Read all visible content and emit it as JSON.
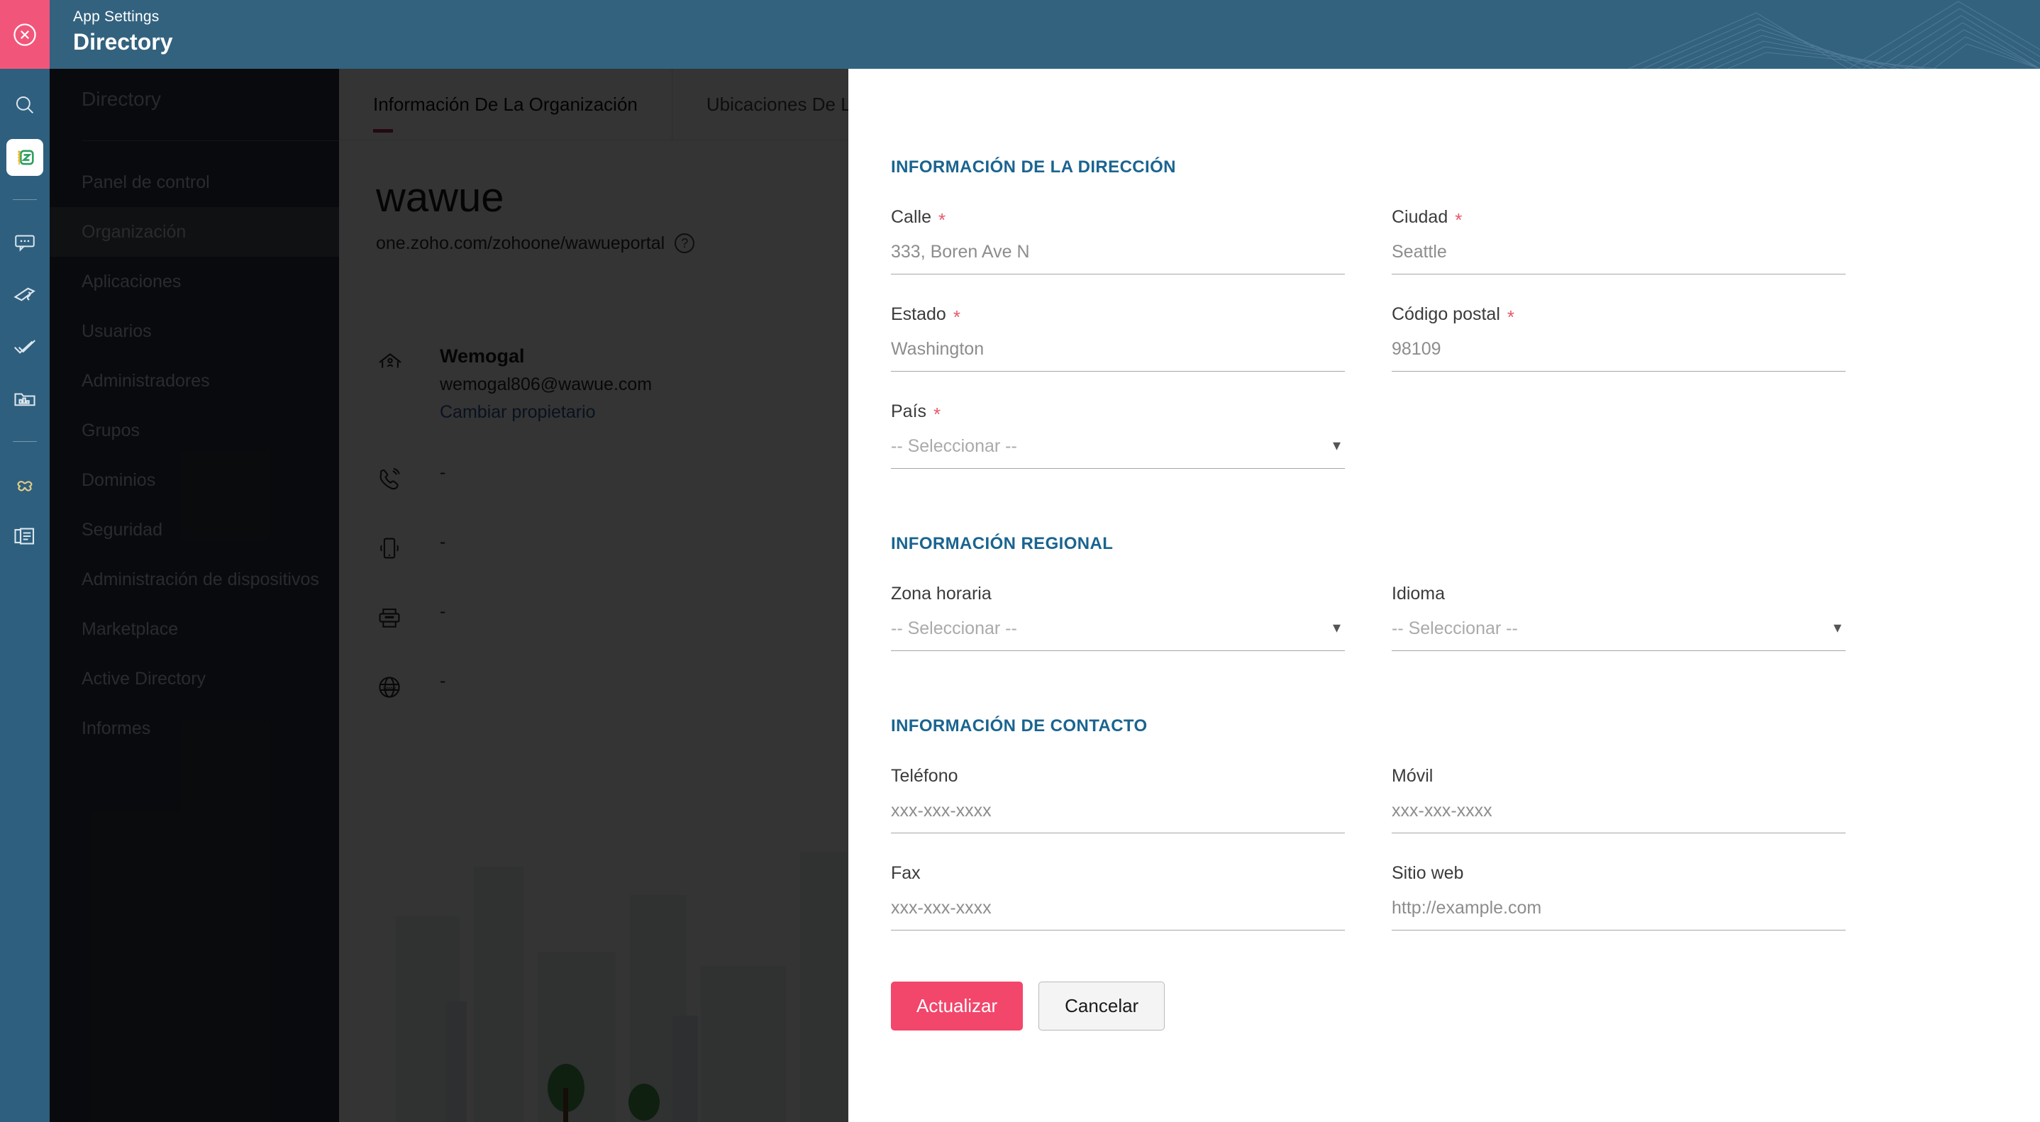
{
  "topbar": {
    "kicker": "App Settings",
    "title": "Directory",
    "close_icon": "close-circle-icon",
    "accent_close_bg": "#f2557a",
    "bg": "#33627f"
  },
  "rail": {
    "bg": "#2e5f7e",
    "items": [
      {
        "icon": "search-icon",
        "active": false
      },
      {
        "icon": "zoho-one-logo-icon",
        "active": true
      },
      {
        "icon": "chat-bubble-icon",
        "active": false
      },
      {
        "icon": "writer-pen-icon",
        "active": false
      },
      {
        "icon": "double-check-icon",
        "active": false
      },
      {
        "icon": "analytics-folder-icon",
        "active": false
      },
      {
        "icon": "flow-puzzle-icon",
        "active": false
      },
      {
        "icon": "documents-stack-icon",
        "active": false
      }
    ]
  },
  "sidebar": {
    "title": "Directory",
    "items": [
      {
        "label": "Panel de control",
        "selected": false
      },
      {
        "label": "Organización",
        "selected": true
      },
      {
        "label": "Aplicaciones",
        "selected": false
      },
      {
        "label": "Usuarios",
        "selected": false
      },
      {
        "label": "Administradores",
        "selected": false
      },
      {
        "label": "Grupos",
        "selected": false
      },
      {
        "label": "Dominios",
        "selected": false
      },
      {
        "label": "Seguridad",
        "selected": false
      },
      {
        "label": "Administración de dispositivos",
        "selected": false
      },
      {
        "label": "Marketplace",
        "selected": false
      },
      {
        "label": "Active Directory",
        "selected": false
      },
      {
        "label": "Informes",
        "selected": false
      }
    ]
  },
  "main": {
    "tabs": [
      {
        "label": "Información De La Organización",
        "active": true
      },
      {
        "label": "Ubicaciones De La Organización",
        "active": false
      }
    ],
    "org_name": "wawue",
    "org_url": "one.zoho.com/zohoone/wawueportal",
    "help_icon": "question-mark-icon",
    "rows": [
      {
        "icon": "home-owner-icon",
        "name": "Wemogal",
        "email": "wemogal806@wawue.com",
        "link": "Cambiar propietario"
      },
      {
        "icon": "phone-icon",
        "value": "-"
      },
      {
        "icon": "mobile-icon",
        "value": "-"
      },
      {
        "icon": "fax-printer-icon",
        "value": "-"
      },
      {
        "icon": "www-globe-icon",
        "value": "-"
      }
    ]
  },
  "panel": {
    "sections": {
      "address": {
        "title": "INFORMACIÓN DE LA DIRECCIÓN",
        "fields": [
          {
            "label": "Calle",
            "required": true,
            "type": "text",
            "placeholder": "333, Boren Ave N"
          },
          {
            "label": "Ciudad",
            "required": true,
            "type": "text",
            "placeholder": "Seattle"
          },
          {
            "label": "Estado",
            "required": true,
            "type": "text",
            "placeholder": "Washington"
          },
          {
            "label": "Código postal",
            "required": true,
            "type": "text",
            "placeholder": "98109"
          },
          {
            "label": "País",
            "required": true,
            "type": "select",
            "placeholder": "-- Seleccionar --"
          }
        ]
      },
      "regional": {
        "title": "INFORMACIÓN REGIONAL",
        "fields": [
          {
            "label": "Zona horaria",
            "required": false,
            "type": "select",
            "placeholder": "-- Seleccionar --"
          },
          {
            "label": "Idioma",
            "required": false,
            "type": "select",
            "placeholder": "-- Seleccionar --"
          }
        ]
      },
      "contact": {
        "title": "INFORMACIÓN DE CONTACTO",
        "fields": [
          {
            "label": "Teléfono",
            "required": false,
            "type": "text",
            "placeholder": "xxx-xxx-xxxx"
          },
          {
            "label": "Móvil",
            "required": false,
            "type": "text",
            "placeholder": "xxx-xxx-xxxx"
          },
          {
            "label": "Fax",
            "required": false,
            "type": "text",
            "placeholder": "xxx-xxx-xxxx"
          },
          {
            "label": "Sitio web",
            "required": false,
            "type": "text",
            "placeholder": "http://example.com"
          }
        ]
      }
    },
    "actions": {
      "primary": "Actualizar",
      "secondary": "Cancelar",
      "primary_color": "#f2466b"
    },
    "chevron_icon": "chevron-down-icon",
    "required_marker": "*"
  }
}
